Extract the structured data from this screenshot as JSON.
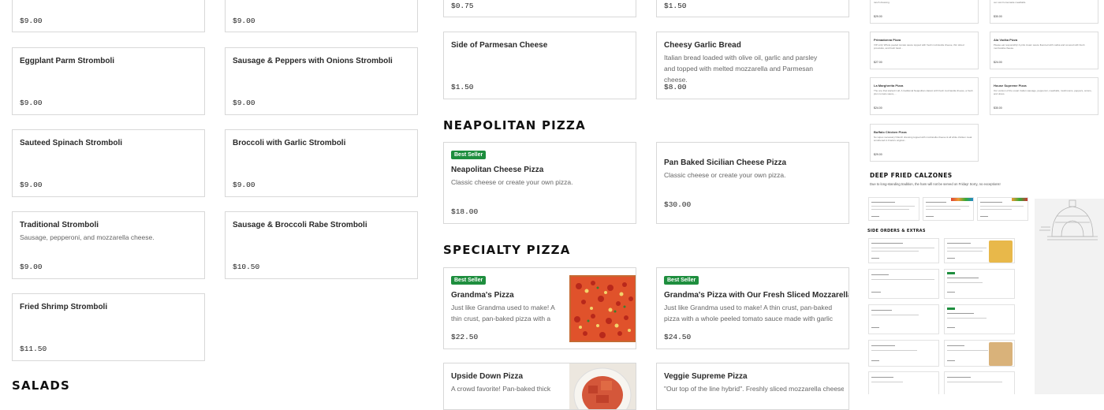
{
  "stromboli_col1": [
    {
      "price": "$9.00"
    },
    {
      "name": "Eggplant Parm Stromboli",
      "price": "$9.00"
    },
    {
      "name": "Sauteed Spinach Stromboli",
      "price": "$9.00"
    },
    {
      "name": "Traditional Stromboli",
      "desc": "Sausage, pepperoni, and mozzarella cheese.",
      "price": "$9.00"
    },
    {
      "name": "Fried Shrimp Stromboli",
      "price": "$11.50"
    }
  ],
  "stromboli_col2": [
    {
      "price": "$9.00"
    },
    {
      "name": "Sausage & Peppers with Onions Stromboli",
      "price": "$9.00"
    },
    {
      "name": "Broccoli with Garlic Stromboli",
      "price": "$9.00"
    },
    {
      "name": "Sausage & Broccoli Rabe Stromboli",
      "price": "$10.50"
    }
  ],
  "salads_heading": "SALADS",
  "sides": [
    {
      "price": "$0.75"
    },
    {
      "price": "$1.50"
    },
    {
      "name": "Side of Parmesan Cheese",
      "price": "$1.50"
    },
    {
      "name": "Cheesy Garlic Bread",
      "desc": "Italian bread loaded with olive oil, garlic and parsley and topped with melted mozzarella and Parmesan cheese.",
      "price": "$8.00"
    }
  ],
  "neapolitan": {
    "heading": "NEAPOLITAN PIZZA",
    "items": [
      {
        "badge": "Best Seller",
        "name": "Neapolitan Cheese Pizza",
        "desc": "Classic cheese or create your own pizza.",
        "price": "$18.00"
      },
      {
        "name": "Pan Baked Sicilian Cheese Pizza",
        "desc": "Classic cheese or create your own pizza.",
        "price": "$30.00"
      }
    ]
  },
  "specialty": {
    "heading": "SPECIALTY PIZZA",
    "items": [
      {
        "badge": "Best Seller",
        "name": "Grandma's Pizza",
        "desc": "Just like Grandma used to make! A thin crust, pan-baked pizza with a whole...",
        "price": "$22.50"
      },
      {
        "badge": "Best Seller",
        "name": "Grandma's Pizza with Our Fresh Sliced Mozzarella",
        "desc": "Just like Grandma used to make! A thin crust, pan-baked pizza with a whole peeled tomato sauce made with garlic and basil...",
        "price": "$24.50"
      },
      {
        "name": "Upside Down Pizza",
        "desc": "A crowd favorite! Pan-baked thick"
      },
      {
        "name": "Veggie Supreme Pizza",
        "desc": "\"Our top of the line hybrid\". Freshly sliced mozzarella cheese,"
      }
    ]
  },
  "thumbnail": {
    "top_items": [
      {
        "desc": "ranch dressing.",
        "price": "$29.00"
      },
      {
        "desc": "our own homemade meatballs.",
        "price": "$30.00"
      },
      {
        "name": "Primadonna Pizza",
        "desc": "VIP only! Whole peeled tomato sauce topped with fresh mozzarella cheese, thin sliced prosciutto, and fresh basil...",
        "price": "$27.00"
      },
      {
        "name": "Ala Vodka Pizza",
        "desc": "Please eat responsibly! A pink cream sauce flavored with vodka and covered with fresh mozzarella cheese.",
        "price": "$24.00"
      },
      {
        "name": "La Margherita Pizza",
        "desc": "The one that started it all. A traditional Neapolitan classic with fresh mozzarella cheese, a fresh plum tomato sauce,...",
        "price": "$24.00"
      },
      {
        "name": "House Supreme Pizza",
        "desc": "Our version of the usual. Italian sausage, pepperoni, meatballs, mushrooms, peppers, onions, and olives.",
        "price": "$30.00"
      },
      {
        "name": "Buffalo Chicken Pizza",
        "desc": "No wipes necessary! Ranch dressing topped with mozzarella cheese & all white chicken meat smothered in Frank's original...",
        "price": "$29.00"
      }
    ],
    "calzones_heading": "DEEP FRIED CALZONES",
    "calzones_note": "Due to long-standing tradition, the ham will not be served on Friday! Sorry, no exceptions!",
    "side_orders_heading": "SIDE ORDERS & EXTRAS"
  },
  "colors": {
    "badge": "#1e8e3e",
    "border": "#d8d8d8"
  },
  "icons": [
    "pizza-oven-illustration"
  ]
}
